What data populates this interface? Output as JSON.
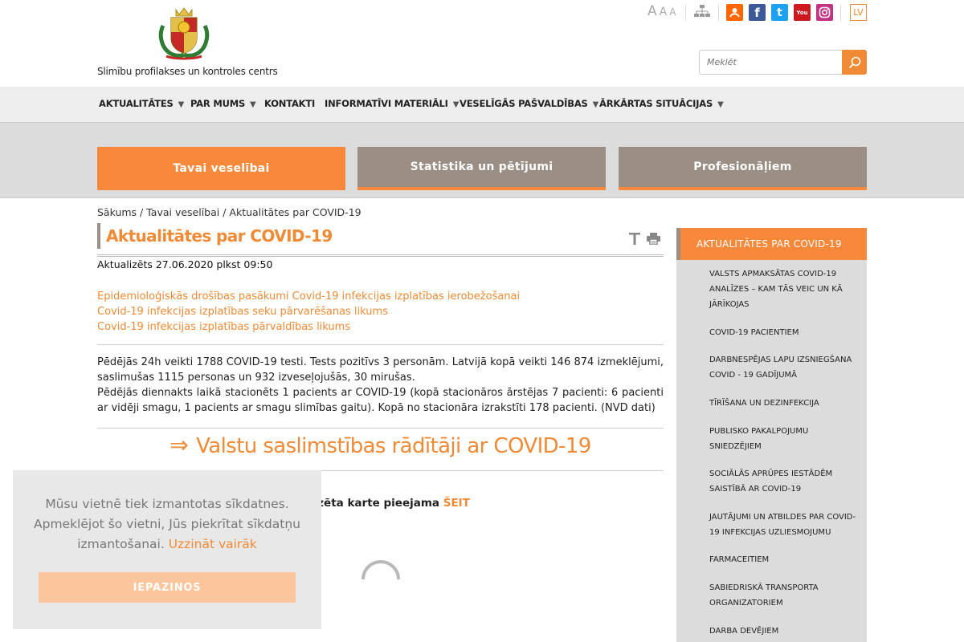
{
  "header": {
    "logo_text": "Slimību profilakses un kontroles centrs",
    "font_size_controls": [
      "A",
      "A",
      "A"
    ],
    "social": [
      {
        "name": "draugiem",
        "label": "",
        "color": "#ff6600"
      },
      {
        "name": "facebook",
        "label": "f",
        "color": "#3b5998"
      },
      {
        "name": "twitter",
        "label": "t",
        "color": "#1da1f2"
      },
      {
        "name": "youtube",
        "label": "You",
        "color": "#cc181e"
      },
      {
        "name": "instagram",
        "label": "",
        "color": "#c13584"
      }
    ],
    "language": "LV",
    "search_placeholder": "Meklēt"
  },
  "nav": {
    "items": [
      {
        "label": "AKTUALITĀTES",
        "has_dropdown": true
      },
      {
        "label": "PAR MUMS",
        "has_dropdown": true
      },
      {
        "label": "KONTAKTI",
        "has_dropdown": false
      },
      {
        "label": "INFORMATĪVI MATERIĀLI",
        "has_dropdown": true
      },
      {
        "label": "VESELĪGĀS PAŠVALDĪBAS",
        "has_dropdown": true
      },
      {
        "label": "ĀRKĀRTAS SITUĀCIJAS",
        "has_dropdown": true
      }
    ],
    "dropdown_glyph": "▼"
  },
  "tiles": [
    "Tavai veselībai",
    "Statistika un pētījumi",
    "Profesionāļiem"
  ],
  "breadcrumb": "Sākums / Tavai veselībai / Aktualitātes par COVID-19",
  "main": {
    "title": "Aktualitātes par COVID-19",
    "updated": "Aktualizēts 27.06.2020 plkst 09:50",
    "links": [
      "Epidemioloģiskās drošības pasākumi Covid-19 infekcijas izplatības ierobežošanai",
      "Covid-19 infekcijas izplatības seku pārvarēšanas likums",
      "Covid-19 infekcijas izplatības pārvaldības likums"
    ],
    "paragraph_1": "Pēdējās 24h veikti 1788 COVID-19 testi. Tests pozitīvs 3 personām. Latvijā kopā veikti 146 874 izmeklējumi, saslimušas 1115 personas un 932 izveseļojušās, 30 mirušas.",
    "paragraph_2": "Pēdējās diennakts laikā stacionēts 1 pacients ar COVID-19 (kopā stacionāros ārstējas 7 pacienti: 6 pacienti ar vidēji smagu, 1 pacients ar smagu slimības gaitu). Kopā no stacionāra izrakstīti 178 pacienti. (NVD dati)",
    "big_heading_arrow": "⇒",
    "big_heading": "Valstu saslimstības rādītāji ar COVID-19",
    "map_text": "Detalizēta karte pieejama ",
    "map_link": "ŠEIT"
  },
  "sidebar": {
    "heading": "AKTUALITĀTES PAR COVID-19",
    "items": [
      "VALSTS APMAKSĀTAS COVID-19 ANALĪZES – KAM TĀS VEIC UN KĀ JĀRĪKOJAS",
      "COVID-19 PACIENTIEM",
      "DARBNESPĒJAS LAPU IZSNIEGŠANA COVID - 19 GADĪJUMĀ",
      "TĪRĪŠANA UN DEZINFEKCIJA",
      "PUBLISKO PAKALPOJUMU SNIEDZĒJIEM",
      "SOCIĀLĀS APRŪPES IESTĀDĒM SAISTĪBĀ AR COVID-19",
      "JAUTĀJUMI UN ATBILDES PAR COVID-19 INFEKCIJAS UZLIESMOJUMU",
      "FARMACEITIEM",
      "SABIEDRISKĀ TRANSPORTA ORGANIZATORIEM",
      "DARBA DEVĒJIEM"
    ]
  },
  "cookie": {
    "text": "Mūsu vietnē tiek izmantotas sīkdatnes. Apmeklējot šo vietni, Jūs piekrītat sīkdatņu izmantošanai.",
    "more_link": "Uzzināt vairāk",
    "button": "IEPAZINOS"
  },
  "colors": {
    "accent": "#f8883a",
    "tile_grey": "#9b8f85",
    "band": "#dcdcdc"
  }
}
